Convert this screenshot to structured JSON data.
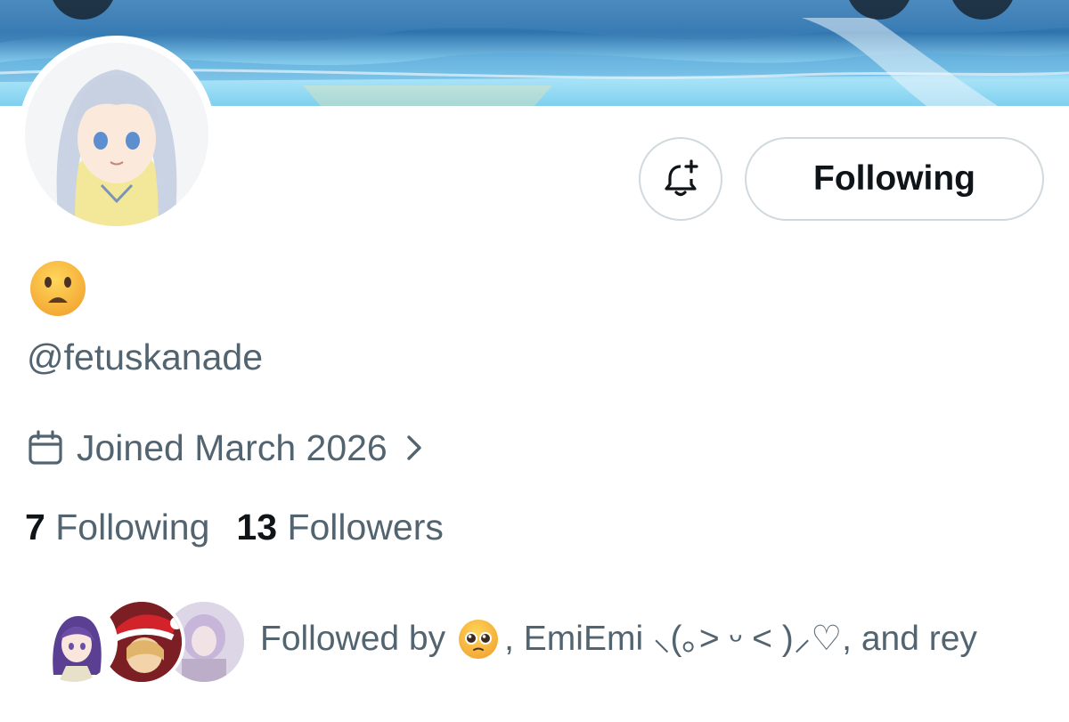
{
  "profile": {
    "display_name_icon": "frowning-face-emoji",
    "handle": "@fetuskanade",
    "joined": "Joined March 2026",
    "following_count": "7",
    "following_label": "Following",
    "followers_count": "13",
    "followers_label": "Followers"
  },
  "actions": {
    "notify_icon": "bell-plus-icon",
    "follow_label": "Following"
  },
  "followed_by": {
    "prefix": "Followed by",
    "names_text": ", EmiEmi ⸜(｡˃ ᵕ ˂ )⸝♡, and rey",
    "first_follower_icon": "pleading-face-emoji"
  },
  "colors": {
    "text_primary": "#0f1419",
    "text_secondary": "#536471",
    "border": "#cfd9de"
  }
}
